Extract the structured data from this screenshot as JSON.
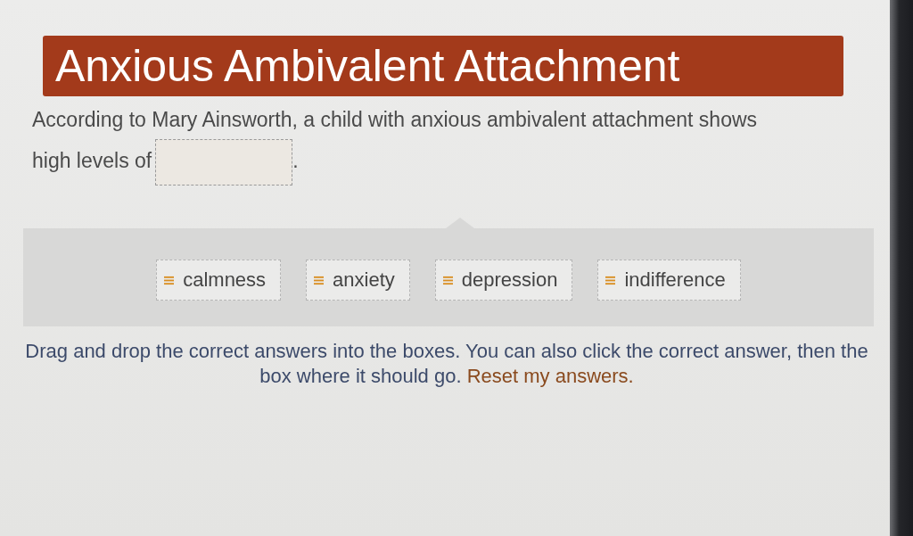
{
  "title": "Anxious Ambivalent Attachment",
  "question": {
    "text": "According to Mary Ainsworth, a child with anxious ambivalent attachment shows high levels of",
    "end": "."
  },
  "options": [
    {
      "label": "calmness"
    },
    {
      "label": "anxiety"
    },
    {
      "label": "depression"
    },
    {
      "label": "indifference"
    }
  ],
  "instructions": {
    "text": "Drag and drop the correct answers into the boxes. You can also click the correct answer, then the box where it should go.",
    "link": "Reset my answers."
  }
}
